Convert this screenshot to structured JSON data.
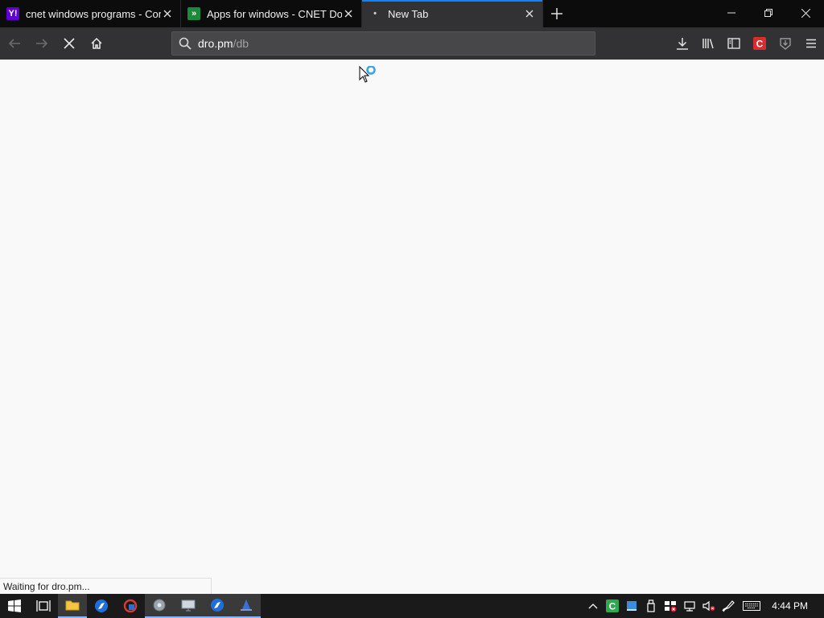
{
  "tabs": [
    {
      "title": "cnet windows programs - Com",
      "favicon": "yahoo-icon",
      "favicon_text": "Y!"
    },
    {
      "title": "Apps for windows - CNET Dow",
      "favicon": "cnet-icon",
      "favicon_text": "»"
    },
    {
      "title": "New Tab",
      "favicon": "loading-dot-icon",
      "favicon_text": "•",
      "active": true
    }
  ],
  "navbar": {
    "url_host": "dro.pm",
    "url_path": "/db"
  },
  "content": {
    "status_text": "Waiting for dro.pm..."
  },
  "taskbar": {
    "clock": "4:44 PM"
  },
  "colors": {
    "accent": "#0a84ff",
    "tabstrip_bg": "#0c0c0d",
    "toolbar_bg": "#323234",
    "content_bg": "#f9f9fa"
  }
}
